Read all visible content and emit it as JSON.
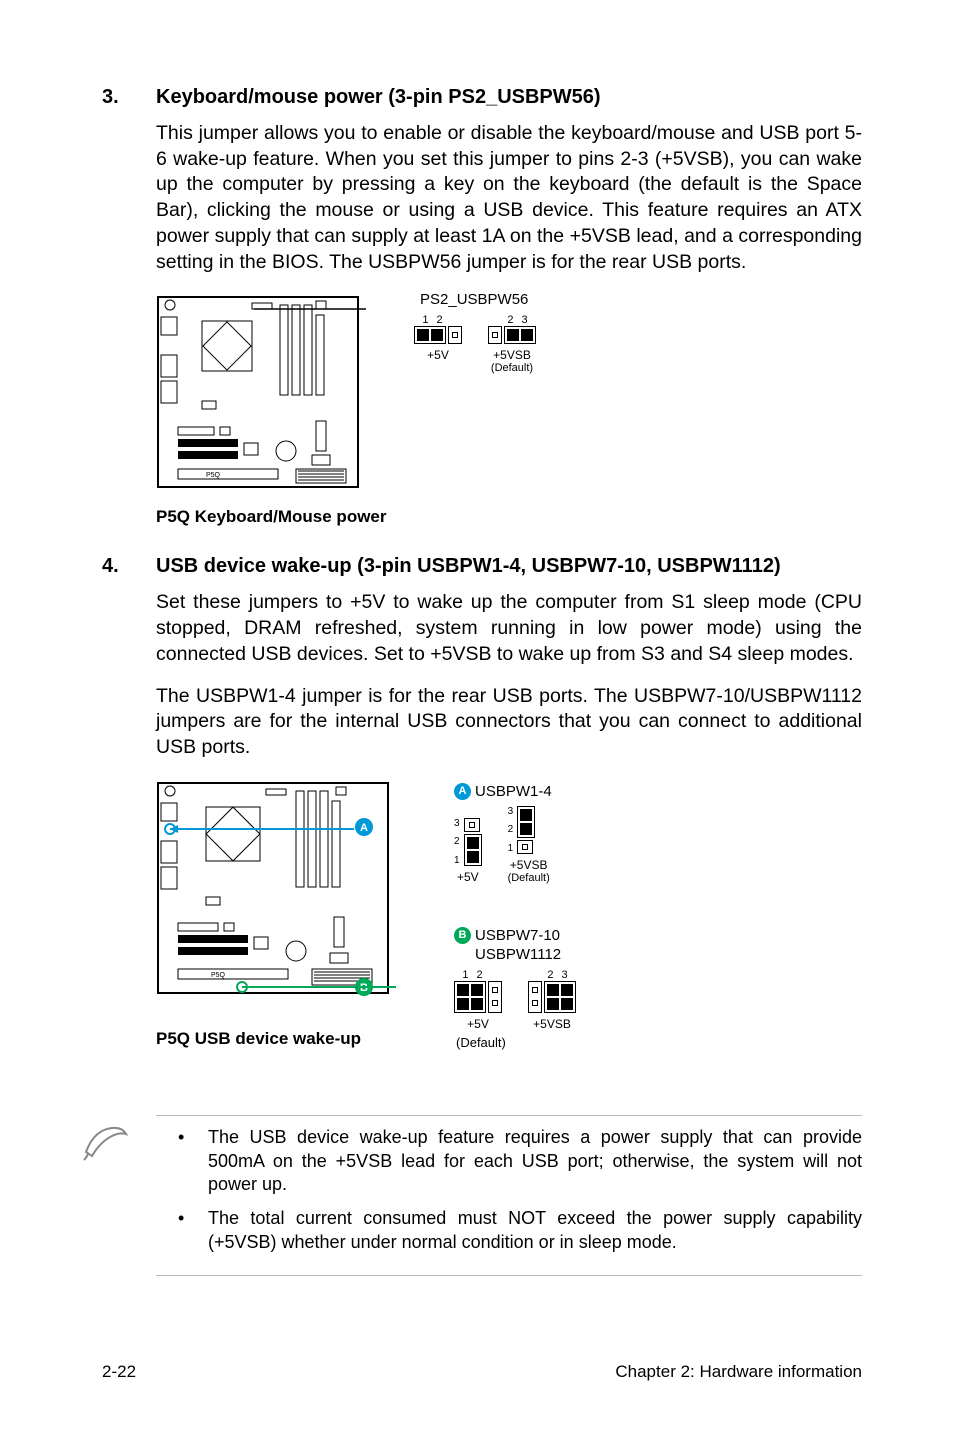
{
  "section3": {
    "number": "3.",
    "title": "Keyboard/mouse power (3-pin PS2_USBPW56)",
    "body": "This jumper allows you to enable or disable the keyboard/mouse and USB port 5-6 wake-up feature. When you set this jumper to pins 2-3 (+5VSB), you can wake up the computer by pressing a key on the keyboard (the default is the Space Bar), clicking the mouse or using a USB device. This feature requires an ATX power supply that can supply at least 1A on the +5VSB lead, and a corresponding setting in the BIOS. The USBPW56 jumper is for the rear USB ports.",
    "diagram": {
      "header": "PS2_USBPW56",
      "left": {
        "pins_lbl_a": "1",
        "pins_lbl_b": "2",
        "volt": "+5V"
      },
      "right": {
        "pins_lbl_a": "2",
        "pins_lbl_b": "3",
        "volt": "+5VSB",
        "default": "(Default)"
      },
      "caption": "P5Q Keyboard/Mouse power"
    }
  },
  "section4": {
    "number": "4.",
    "title": "USB device wake-up (3-pin USBPW1-4, USBPW7-10, USBPW1112)",
    "para1": "Set these jumpers to +5V to wake up the computer from S1 sleep mode (CPU stopped, DRAM refreshed, system running in low power mode) using the connected USB devices. Set to +5VSB to wake up from S3 and S4 sleep modes.",
    "para2": "The USBPW1-4 jumper is for the rear USB ports. The USBPW7-10/USBPW1112 jumpers are for the internal USB connectors that you can connect to additional USB ports.",
    "diagram": {
      "clusterA": {
        "badge": "A",
        "title": "USBPW1-4",
        "left": {
          "p1": "1",
          "p2": "2",
          "p3": "3",
          "volt": "+5V"
        },
        "right": {
          "p1": "3",
          "p2": "2",
          "p3": "1",
          "volt": "+5VSB",
          "default": "(Default)"
        }
      },
      "clusterB": {
        "badge": "B",
        "title1": "USBPW7-10",
        "title2": "USBPW1112",
        "left": {
          "pins_lbl_a": "1",
          "pins_lbl_b": "2",
          "volt": "+5V",
          "default": "(Default)"
        },
        "right": {
          "pins_lbl_a": "2",
          "pins_lbl_b": "3",
          "volt": "+5VSB"
        }
      },
      "caption": "P5Q USB device wake-up",
      "default_below": "(Default)"
    }
  },
  "notes": {
    "item1": "The USB device wake-up feature requires a power supply that can provide 500mA on the +5VSB lead for each USB port; otherwise, the system will not power up.",
    "item2": "The total current consumed must NOT exceed the power supply capability (+5VSB) whether under normal condition or in sleep mode."
  },
  "footer": {
    "page": "2-22",
    "chapter": "Chapter 2: Hardware information"
  }
}
